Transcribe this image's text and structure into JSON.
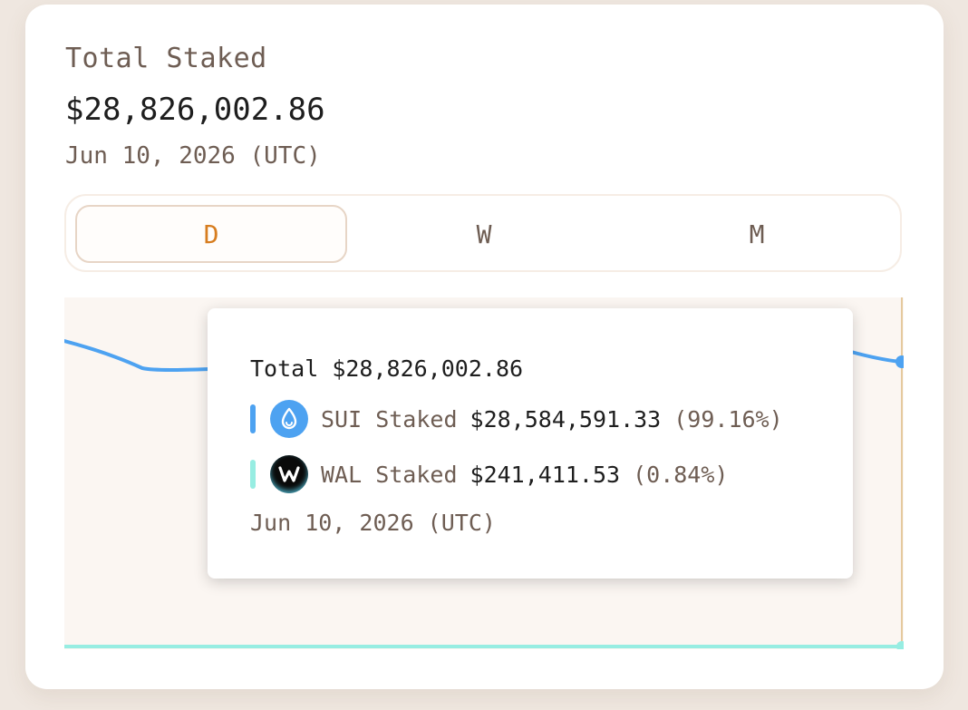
{
  "summary": {
    "label": "Total Staked",
    "amount": "$28,826,002.86",
    "date": "Jun 10, 2026 (UTC)"
  },
  "tabs": [
    {
      "label": "D",
      "active": true
    },
    {
      "label": "W",
      "active": false
    },
    {
      "label": "M",
      "active": false
    }
  ],
  "colors": {
    "accent": "#d77d1f",
    "sui_series": "#4da2f1",
    "wal_series": "#97ede2"
  },
  "tooltip": {
    "total_label": "Total",
    "total_value": "$28,826,002.86",
    "rows": [
      {
        "icon": "sui-droplet-icon",
        "name": "SUI Staked",
        "value": "$28,584,591.33",
        "pct": "(99.16%)"
      },
      {
        "icon": "wal-w-icon",
        "name": "WAL Staked",
        "value": "$241,411.53",
        "pct": "(0.84%)"
      }
    ],
    "date": "Jun 10, 2026 (UTC)"
  }
}
